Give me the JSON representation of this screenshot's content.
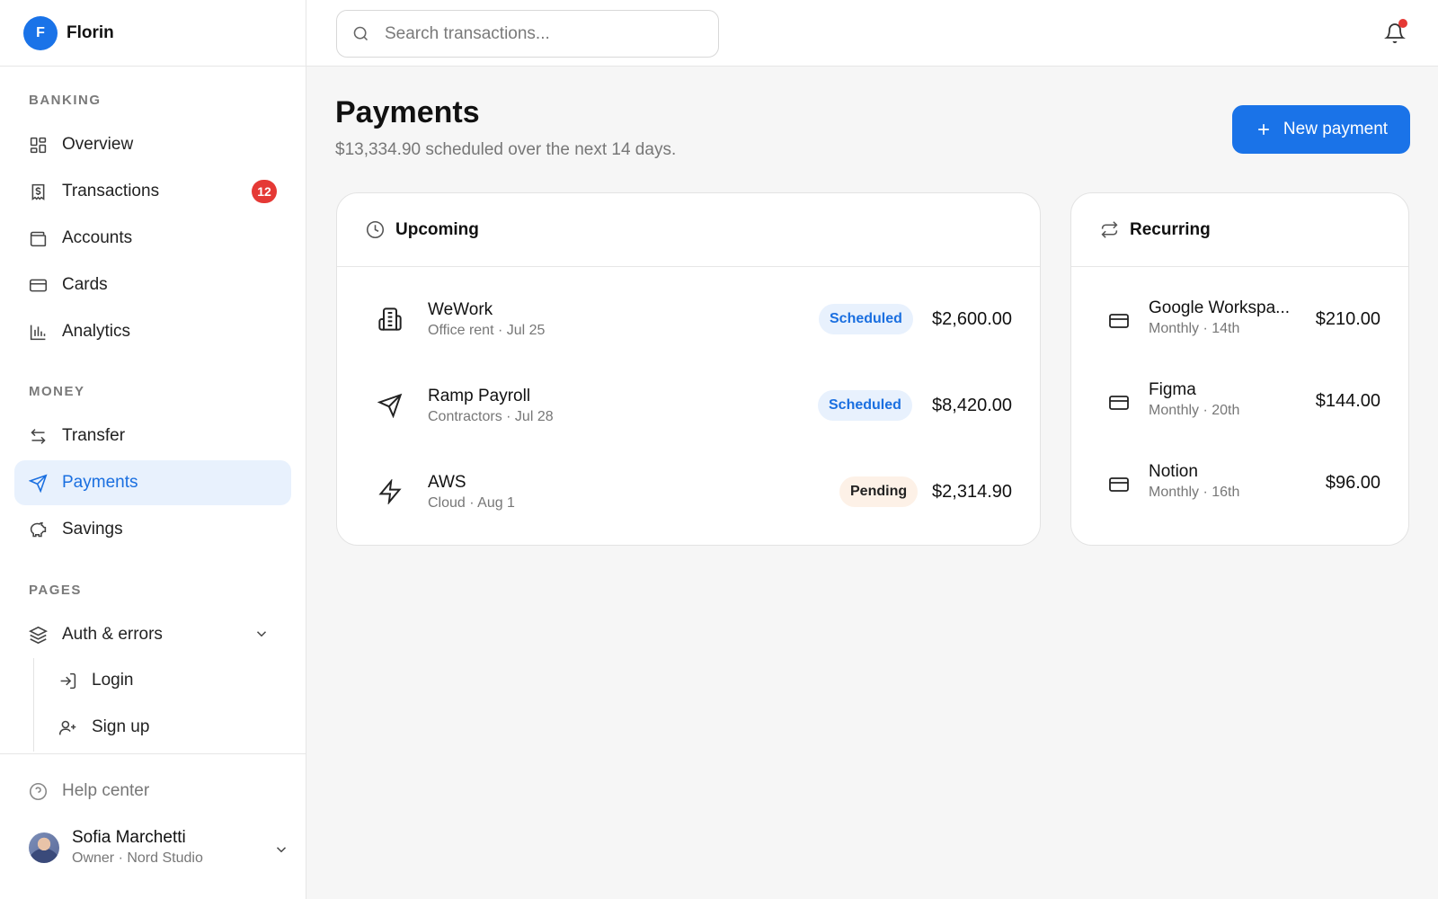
{
  "brand": {
    "logo_letter": "F",
    "name": "Florin"
  },
  "sidebar": {
    "sections": [
      {
        "label": "BANKING"
      },
      {
        "label": "MONEY"
      },
      {
        "label": "PAGES"
      }
    ],
    "banking": [
      {
        "label": "Overview",
        "icon": "grid-icon"
      },
      {
        "label": "Transactions",
        "icon": "receipt-icon",
        "badge": "12"
      },
      {
        "label": "Accounts",
        "icon": "wallet-icon"
      },
      {
        "label": "Cards",
        "icon": "credit-card-icon"
      },
      {
        "label": "Analytics",
        "icon": "bar-chart-icon"
      }
    ],
    "money": [
      {
        "label": "Transfer",
        "icon": "transfer-arrows-icon"
      },
      {
        "label": "Payments",
        "icon": "send-icon",
        "active": true
      },
      {
        "label": "Savings",
        "icon": "piggy-bank-icon"
      }
    ],
    "pages": {
      "group_label": "Auth & errors",
      "group_icon": "layers-icon",
      "items": [
        {
          "label": "Login",
          "icon": "login-icon"
        },
        {
          "label": "Sign up",
          "icon": "user-plus-icon"
        }
      ]
    },
    "help_label": "Help center",
    "user": {
      "name": "Sofia Marchetti",
      "role": "Owner · Nord Studio"
    }
  },
  "topbar": {
    "search_placeholder": "Search transactions...",
    "notification_dot_color": "#e53935"
  },
  "main": {
    "title": "Payments",
    "subtitle": "$13,334.90 scheduled over the next 14 days.",
    "new_button_label": "New payment",
    "accent_color": "#1a73e8"
  },
  "upcoming": {
    "title": "Upcoming",
    "rows": [
      {
        "name": "WeWork",
        "meta": "Office rent · Jul 25",
        "status": "Scheduled",
        "amount": "$2,600.00",
        "icon": "building-icon"
      },
      {
        "name": "Ramp Payroll",
        "meta": "Contractors · Jul 28",
        "status": "Scheduled",
        "amount": "$8,420.00",
        "icon": "send-icon"
      },
      {
        "name": "AWS",
        "meta": "Cloud · Aug 1",
        "status": "Pending",
        "amount": "$2,314.90",
        "icon": "lightning-icon"
      }
    ]
  },
  "recurring": {
    "title": "Recurring",
    "rows": [
      {
        "name": "Google Workspa...",
        "meta": "Monthly · 14th",
        "amount": "$210.00",
        "icon": "credit-card-icon"
      },
      {
        "name": "Figma",
        "meta": "Monthly · 20th",
        "amount": "$144.00",
        "icon": "credit-card-icon"
      },
      {
        "name": "Notion",
        "meta": "Monthly · 16th",
        "amount": "$96.00",
        "icon": "credit-card-icon"
      }
    ]
  }
}
